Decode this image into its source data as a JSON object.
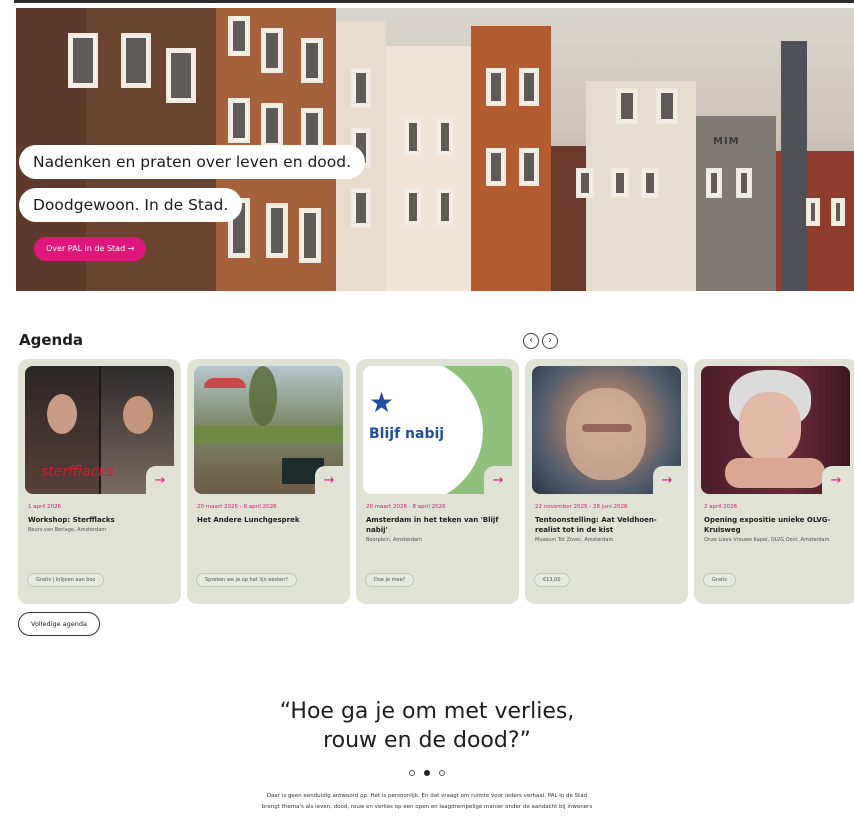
{
  "hero": {
    "line1": "Nadenken en praten over leven en dood.",
    "line2": "Doodgewoon. In de Stad.",
    "button_label": "Over PAL in de Stad  →",
    "building_sign": "MIM"
  },
  "agenda": {
    "title": "Agenda",
    "prev_icon": "‹",
    "next_icon": "›",
    "arrow_icon": "→",
    "cards": [
      {
        "date": "1 april 2026",
        "title": "Workshop: Sterfflacks",
        "location": "Beurs van Berlage, Amsterdam",
        "tag": "Gratis | Inlijven aan bos",
        "img_text": "sterfflacks"
      },
      {
        "date": "20 maart 2026 - 8 april 2026",
        "title": "Het Andere Lunchgesprek",
        "location": "",
        "tag": "Spreken we je op het lijn eesten?",
        "img_text": ""
      },
      {
        "date": "20 maart 2026 - 8 april 2026",
        "title": "Amsterdam in het teken van 'Blijf nabij'",
        "location": "Boorplein, Amsterdam",
        "tag": "Doe je mee?",
        "img_text": "Blijf nabij"
      },
      {
        "date": "22 november 2025 - 28 juni 2026",
        "title": "Tentoonstelling: Aat Veldhoen-realist tot in de kist",
        "location": "Museum Tot Zover, Amsterdam",
        "tag": "€13,00",
        "img_text": ""
      },
      {
        "date": "2 april 2026",
        "title": "Opening expositie unieke OLVG-Kruisweg",
        "location": "Onze Lieve Vrouwe Kapel, OLVG Oost, Amsterdam",
        "tag": "Gratis",
        "img_text": ""
      }
    ],
    "full_button": "Volledige agenda"
  },
  "quote": {
    "line1": "“Hoe ga je om met verlies,",
    "line2": "rouw en de dood?”"
  },
  "intro": {
    "line1": "Daar is geen eenduidig antwoord op. Het is persoonlijk. En dat vraagt om ruimte voor ieders verhaal. PAL in de Stad",
    "line2": "brengt thema's als leven, dood, rouw en verlies op een open en laagdrempelige manier onder de aandacht bij inwoners"
  },
  "colors": {
    "accent": "#e0177a",
    "card_bg": "#dfe2d5",
    "text": "#1d1d1d"
  }
}
